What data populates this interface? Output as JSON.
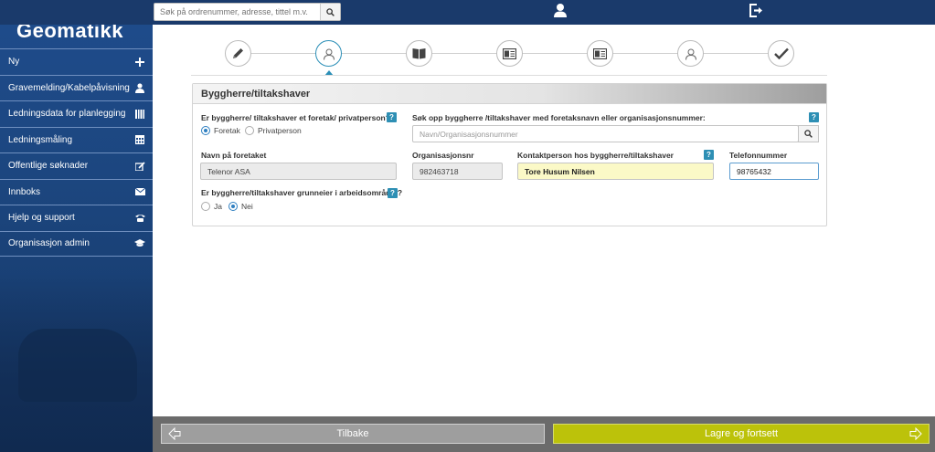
{
  "search": {
    "placeholder": "Søk på ordrenummer, adresse, tittel m.v."
  },
  "logo": {
    "text": "Geomatikk"
  },
  "menu": [
    {
      "label": "Ny",
      "icon": "plus-icon"
    },
    {
      "label": "Gravemelding/Kabelpåvisning",
      "icon": "person-icon"
    },
    {
      "label": "Ledningsdata for planlegging",
      "icon": "grid-icon"
    },
    {
      "label": "Ledningsmåling",
      "icon": "table-icon"
    },
    {
      "label": "Offentlige søknader",
      "icon": "edit-icon"
    },
    {
      "label": "Innboks",
      "icon": "envelope-icon"
    },
    {
      "label": "Hjelp og support",
      "icon": "phone-icon"
    },
    {
      "label": "Organisasjon admin",
      "icon": "graduation-cap-icon"
    }
  ],
  "steps": [
    {
      "icon": "pencil-icon",
      "active": false
    },
    {
      "icon": "person-icon",
      "active": true
    },
    {
      "icon": "book-icon",
      "active": false
    },
    {
      "icon": "map-icon",
      "active": false
    },
    {
      "icon": "map-icon",
      "active": false
    },
    {
      "icon": "person-icon",
      "active": false
    },
    {
      "icon": "check-icon",
      "active": false
    }
  ],
  "panel": {
    "title": "Byggherre/tiltakshaver",
    "question_type": "Er byggherre/ tiltakshaver et foretak/ privatperson?",
    "radio_foretak": "Foretak",
    "radio_privatperson": "Privatperson",
    "search_label": "Søk opp byggherre /tiltakshaver med foretaksnavn eller organisasjonsnummer:",
    "search_placeholder": "Navn/Organisasjonsnummer",
    "company_name_label": "Navn på foretaket",
    "company_name_value": "Telenor ASA",
    "org_label": "Organisasjonsnr",
    "org_value": "982463718",
    "contact_label": "Kontaktperson hos byggherre/tiltakshaver",
    "contact_value": "Tore Husum Nilsen",
    "phone_label": "Telefonnummer",
    "phone_value": "98765432",
    "question_owner": "Er byggherre/tiltakshaver grunneier i arbeidsområdet?",
    "radio_ja": "Ja",
    "radio_nei": "Nei",
    "help_text": "?"
  },
  "footer": {
    "back_label": "Tilbake",
    "save_label": "Lagre og fortsett"
  },
  "colors": {
    "sidebar": "#1f4c8c",
    "topbar": "#1a3a6b",
    "accent": "#2b8fb7",
    "save": "#bcc20a",
    "back": "#9e9e9e"
  }
}
